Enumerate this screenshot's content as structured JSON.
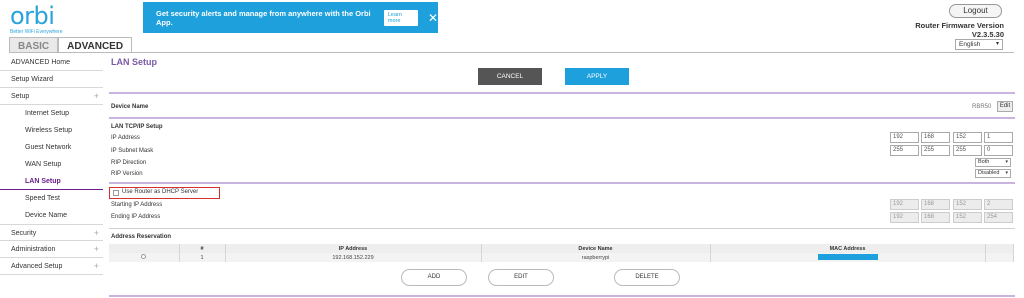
{
  "brand": {
    "logo": "orbi",
    "tagline": "Better WiFi Everywhere",
    "color": "#29a3dc"
  },
  "tabs": [
    {
      "label": "BASIC"
    },
    {
      "label": "ADVANCED"
    }
  ],
  "banner": {
    "text": "Get security alerts and manage from anywhere with the Orbi App.",
    "learn_more": "Learn more",
    "close": "✕",
    "color": "#1ea0dc"
  },
  "header": {
    "logout": "Logout",
    "firmware_label": "Router Firmware Version",
    "firmware_version": "V2.3.5.30",
    "language": "English"
  },
  "sidebar": {
    "items": [
      {
        "label": "ADVANCED Home"
      },
      {
        "label": "Setup Wizard"
      },
      {
        "label": "Setup",
        "expand": "+"
      }
    ],
    "sub_items": [
      {
        "label": "Internet Setup"
      },
      {
        "label": "Wireless Setup"
      },
      {
        "label": "Guest Network"
      },
      {
        "label": "WAN Setup"
      },
      {
        "label": "LAN Setup"
      },
      {
        "label": "Speed Test"
      },
      {
        "label": "Device Name"
      }
    ],
    "bottom_items": [
      {
        "label": "Security",
        "expand": "+"
      },
      {
        "label": "Administration",
        "expand": "+"
      },
      {
        "label": "Advanced Setup",
        "expand": "+"
      }
    ]
  },
  "main": {
    "title": "LAN Setup",
    "cancel": "CANCEL",
    "apply": "APPLY",
    "device_name_label": "Device Name",
    "device_name_value": "RBR50",
    "edit": "Edit",
    "lan_section": "LAN TCP/IP Setup",
    "ip_address_label": "IP Address",
    "ip_address": [
      "192",
      "168",
      "152",
      "1"
    ],
    "subnet_label": "IP Subnet Mask",
    "subnet": [
      "255",
      "255",
      "255",
      "0"
    ],
    "rip_direction_label": "RIP Direction",
    "rip_direction": "Both",
    "rip_version_label": "RIP Version",
    "rip_version": "Disabled",
    "dhcp_label": "Use Router as DHCP Server",
    "dhcp_checked": false,
    "start_ip_label": "Starting IP Address",
    "start_ip": [
      "192",
      "168",
      "152",
      "2"
    ],
    "end_ip_label": "Ending IP Address",
    "end_ip": [
      "192",
      "168",
      "152",
      "254"
    ],
    "reservation_section": "Address Reservation",
    "table": {
      "headers": [
        "",
        "#",
        "IP Address",
        "Device Name",
        "MAC Address"
      ],
      "rows": [
        {
          "num": "1",
          "ip": "192.168.152.229",
          "device": "raspberrypi"
        }
      ]
    },
    "add": "ADD",
    "edit_btn": "EDIT",
    "delete": "DELETE",
    "accent": "#c9b3e0"
  }
}
